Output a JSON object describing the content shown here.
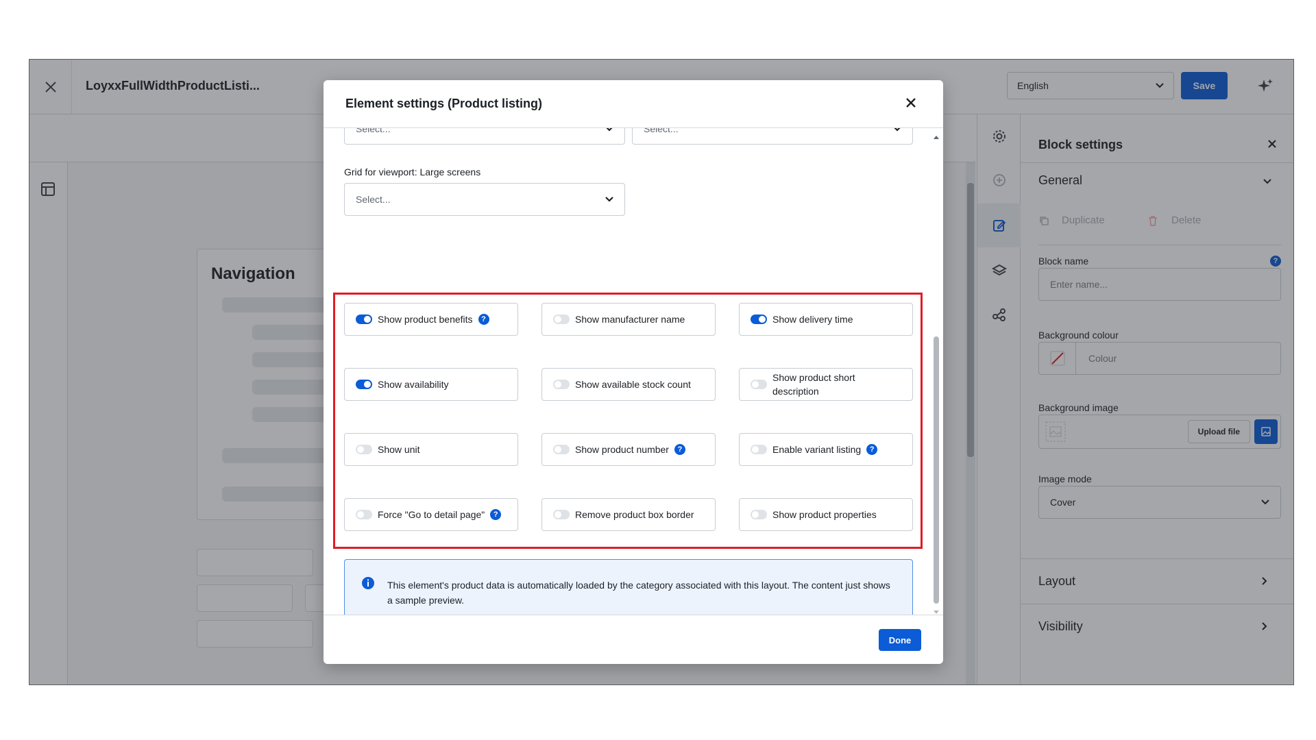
{
  "app": {
    "document_title": "LoyxxFullWidthProductListi...",
    "language_value": "English",
    "save_label": "Save"
  },
  "canvas": {
    "navigation_heading": "Navigation"
  },
  "block_settings": {
    "title": "Block settings",
    "general_label": "General",
    "duplicate_label": "Duplicate",
    "delete_label": "Delete",
    "block_name_label": "Block name",
    "block_name_placeholder": "Enter name...",
    "background_colour_label": "Background colour",
    "colour_placeholder": "Colour",
    "background_image_label": "Background image",
    "upload_file_label": "Upload file",
    "image_mode_label": "Image mode",
    "image_mode_value": "Cover",
    "layout_label": "Layout",
    "visibility_label": "Visibility"
  },
  "modal": {
    "title": "Element settings (Product listing)",
    "top_select_left": "Select...",
    "top_select_right": "Select...",
    "grid_large_label": "Grid for viewport: Large screens",
    "grid_large_placeholder": "Select...",
    "options": [
      {
        "label": "Show product benefits",
        "on": true,
        "help": true
      },
      {
        "label": "Show manufacturer name",
        "on": false,
        "help": false
      },
      {
        "label": "Show delivery time",
        "on": true,
        "help": false
      },
      {
        "label": "Show availability",
        "on": true,
        "help": false
      },
      {
        "label": "Show available stock count",
        "on": false,
        "help": false
      },
      {
        "label": "Show product short description",
        "on": false,
        "help": false
      },
      {
        "label": "Show unit",
        "on": false,
        "help": false
      },
      {
        "label": "Show product number",
        "on": false,
        "help": true
      },
      {
        "label": "Enable variant listing",
        "on": false,
        "help": true
      },
      {
        "label": "Force \"Go to detail page\"",
        "on": false,
        "help": true
      },
      {
        "label": "Remove product box border",
        "on": false,
        "help": false
      },
      {
        "label": "Show product properties",
        "on": false,
        "help": false
      }
    ],
    "info_text": "This element's product data is automatically loaded by the category associated with this layout. The content just shows a sample preview.",
    "done_label": "Done",
    "help_glyph": "?"
  },
  "colors": {
    "accent": "#0b5cd6",
    "highlight": "#e01b24"
  }
}
